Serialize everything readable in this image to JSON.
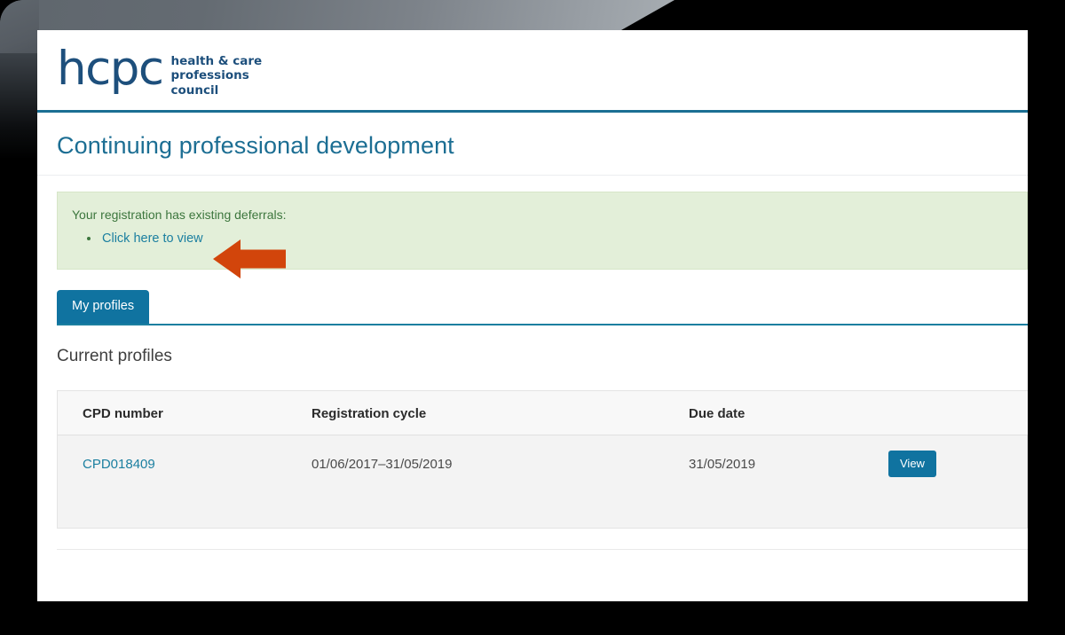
{
  "brand": {
    "logo_wordmark": "hcpc",
    "logo_strapline": "health & care\nprofessions\ncouncil",
    "accent_teal": "#1b7fa0",
    "accent_navy": "#1d4f7c",
    "header_rule": "#1b6f93"
  },
  "page": {
    "title": "Continuing professional development"
  },
  "alert": {
    "message": "Your registration has existing deferrals:",
    "items": [
      {
        "label": "Click here to view"
      }
    ],
    "background": "#e3efd9",
    "text_color": "#3c763d"
  },
  "annotation": {
    "arrow_icon": "arrow-left-icon",
    "color": "#d2450b",
    "points_at": "Click here to view"
  },
  "tabs": [
    {
      "label": "My profiles",
      "active": true
    }
  ],
  "section": {
    "heading": "Current profiles"
  },
  "table": {
    "columns": [
      "CPD number",
      "Registration cycle",
      "Due date",
      ""
    ],
    "rows": [
      {
        "cpd_number": "CPD018409",
        "registration_cycle": "01/06/2017–31/05/2019",
        "due_date": "31/05/2019",
        "action_label": "View"
      }
    ]
  }
}
